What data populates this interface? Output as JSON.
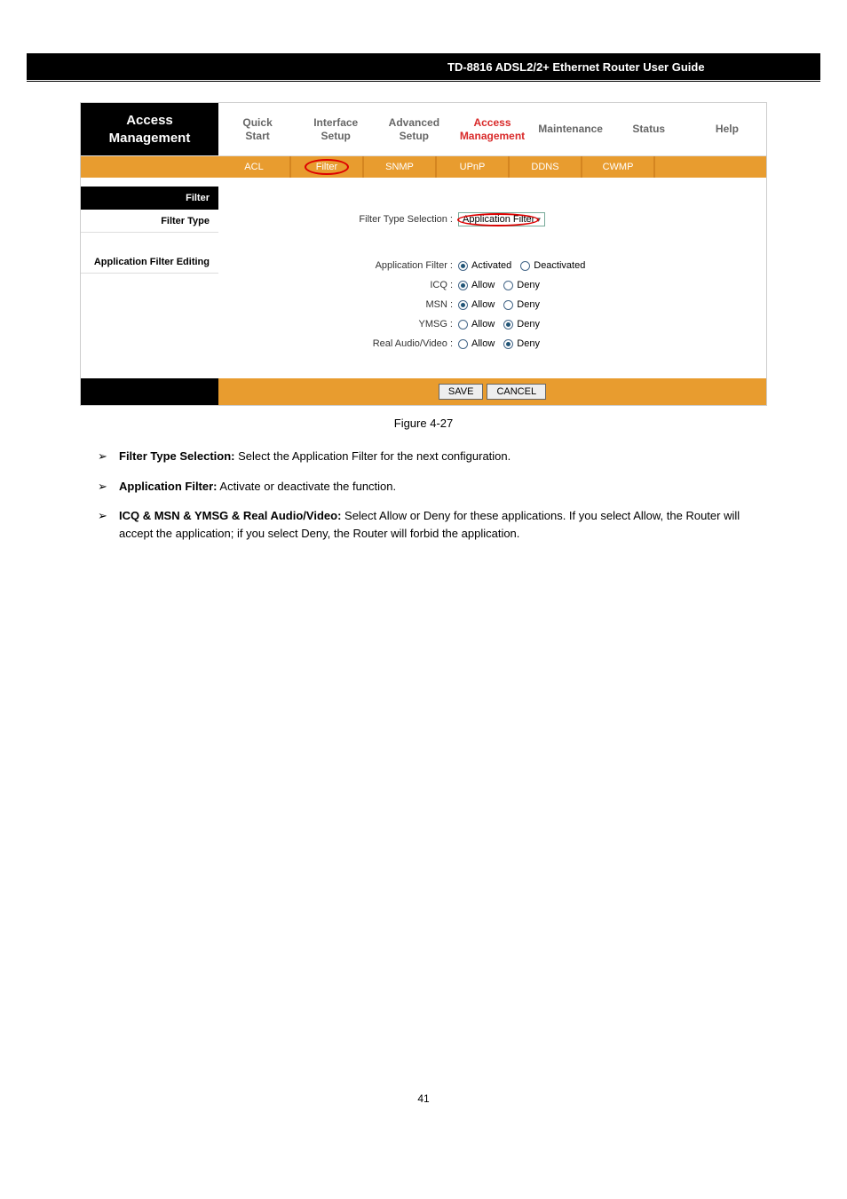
{
  "document_header": "TD-8816 ADSL2/2+ Ethernet Router User Guide",
  "sidebar_title_line1": "Access",
  "sidebar_title_line2": "Management",
  "topnav": [
    {
      "label_line1": "Quick",
      "label_line2": "Start"
    },
    {
      "label_line1": "Interface",
      "label_line2": "Setup"
    },
    {
      "label_line1": "Advanced",
      "label_line2": "Setup"
    },
    {
      "label_line1": "Access",
      "label_line2": "Management",
      "active": true
    },
    {
      "label_line1": "Maintenance",
      "label_line2": ""
    },
    {
      "label_line1": "Status",
      "label_line2": ""
    },
    {
      "label_line1": "Help",
      "label_line2": ""
    }
  ],
  "subnav": [
    {
      "label": "ACL"
    },
    {
      "label": "Filter",
      "active": true
    },
    {
      "label": "SNMP"
    },
    {
      "label": "UPnP"
    },
    {
      "label": "DDNS"
    },
    {
      "label": "CWMP"
    }
  ],
  "section_filter": "Filter",
  "section_filter_type": "Filter Type",
  "section_app_filter": "Application Filter Editing",
  "field_filter_type_selection": "Filter Type Selection :",
  "dropdown_value": "Application Filter",
  "rows": [
    {
      "label": "Application Filter :",
      "opt1": "Activated",
      "opt2": "Deactivated",
      "selected": 1
    },
    {
      "label": "ICQ :",
      "opt1": "Allow",
      "opt2": "Deny",
      "selected": 1
    },
    {
      "label": "MSN :",
      "opt1": "Allow",
      "opt2": "Deny",
      "selected": 1
    },
    {
      "label": "YMSG :",
      "opt1": "Allow",
      "opt2": "Deny",
      "selected": 2
    },
    {
      "label": "Real Audio/Video :",
      "opt1": "Allow",
      "opt2": "Deny",
      "selected": 2
    }
  ],
  "btn_save": "SAVE",
  "btn_cancel": "CANCEL",
  "figure_caption": "Figure 4-27",
  "descriptions": [
    {
      "term": "Filter Type Selection:",
      "text": " Select the Application Filter for the next configuration."
    },
    {
      "term": "Application Filter:",
      "text": " Activate or deactivate the function."
    },
    {
      "term": "ICQ & MSN & YMSG & Real Audio/Video:",
      "text": " Select Allow or Deny for these applications. If you select Allow, the Router will accept the application; if you select Deny, the Router will forbid the application."
    }
  ],
  "page_number": "41"
}
